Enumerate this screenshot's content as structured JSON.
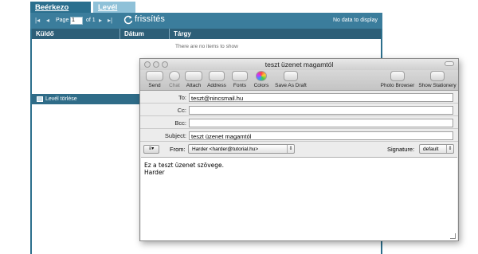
{
  "app": {
    "tabs": [
      "Beérkezo levelek",
      "Levél írása"
    ],
    "pager": {
      "page_label": "Page",
      "page_value": "1",
      "of_label": "of 1",
      "refresh_label": "frissítés",
      "no_data": "No data to display"
    },
    "columns": [
      "Küldő",
      "Dátum",
      "Tárgy"
    ],
    "no_items": "There are no items to show",
    "delete_label": "Levél törlése"
  },
  "mail_window": {
    "title": "teszt üzenet magamtól",
    "toolbar": [
      {
        "label": "Send",
        "icon": "send-icon"
      },
      {
        "label": "Chat",
        "icon": "chat-icon"
      },
      {
        "label": "Attach",
        "icon": "paperclip-icon"
      },
      {
        "label": "Address",
        "icon": "address-book-icon"
      },
      {
        "label": "Fonts",
        "icon": "fonts-icon"
      },
      {
        "label": "Colors",
        "icon": "color-wheel-icon"
      },
      {
        "label": "Save As Draft",
        "icon": "draft-icon"
      },
      {
        "label": "Photo Browser",
        "icon": "photo-browser-icon"
      },
      {
        "label": "Show Stationery",
        "icon": "stationery-icon"
      }
    ],
    "fields": {
      "to_label": "To:",
      "to_value": "teszt@nincsmail.hu",
      "cc_label": "Cc:",
      "cc_value": "",
      "bcc_label": "Bcc:",
      "bcc_value": "",
      "subject_label": "Subject:",
      "subject_value": "teszt üzenet magamtól"
    },
    "from": {
      "label": "From:",
      "value": "Harder <harder@tutorial.hu>",
      "menu_glyph": "≡▾"
    },
    "signature": {
      "label": "Signature:",
      "value": "default"
    },
    "body": [
      "Ez a teszt üzenet szövege.",
      "Harder"
    ]
  },
  "colors": {
    "accent": "#2a6f8e",
    "tab_inactive": "#8fc1d8",
    "header_dark": "#2d5f78"
  }
}
